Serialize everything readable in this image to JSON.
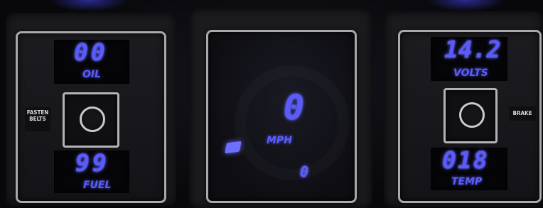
{
  "left_gauge": {
    "oil_value": "00",
    "oil_label": "OIL",
    "fuel_value": "99",
    "fuel_label": "FUEL",
    "warning_line1": "FASTEN",
    "warning_line2": "BELTS"
  },
  "center_gauge": {
    "speed_value": "0",
    "speed_unit": "MPH",
    "trip_value": "0"
  },
  "right_gauge": {
    "volts_value": "14.2",
    "volts_label": "VOLTS",
    "temp_value": "018",
    "temp_label": "TEMP",
    "warning_label": "BRAKE"
  },
  "colors": {
    "display_blue": "#5a5bff",
    "bezel_chrome": "#a9a9ab",
    "panel_background": "#141418"
  },
  "icons": {
    "knob": "adjustment-knob-icon",
    "indicator": "turn-indicator-icon"
  }
}
